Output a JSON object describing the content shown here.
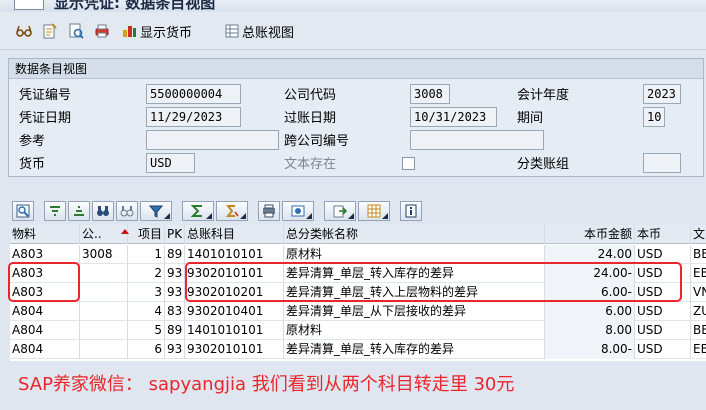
{
  "window": {
    "title": "显示凭证: 数据条目视图"
  },
  "toolbar": {
    "show_currency": "显示货币",
    "gl_view": "总账视图"
  },
  "panel": {
    "title": "数据条目视图",
    "doc_no_label": "凭证编号",
    "doc_no": "5500000004",
    "company_code_label": "公司代码",
    "company_code": "3008",
    "fiscal_year_label": "会计年度",
    "fiscal_year": "2023",
    "doc_date_label": "凭证日期",
    "doc_date": "11/29/2023",
    "posting_date_label": "过账日期",
    "posting_date": "10/31/2023",
    "period_label": "期间",
    "period": "10",
    "reference_label": "参考",
    "reference": "",
    "cross_cc_label": "跨公司编号",
    "cross_cc": "",
    "currency_label": "货币",
    "currency": "USD",
    "text_exists_label": "文本存在",
    "ledger_group_label": "分类账组",
    "ledger_group": ""
  },
  "grid": {
    "headers": {
      "material": "物料",
      "company": "公..",
      "item": "项目",
      "pk": "PK",
      "gl": "总账科目",
      "gl_name": "总分类帐名称",
      "amount": "本币金额",
      "currency": "本币",
      "text": "文"
    },
    "rows": [
      {
        "material": "A803",
        "company": "3008",
        "item": "1",
        "pk": "89",
        "gl": "1401010101",
        "gl_name": "原材料",
        "amount": "24.00",
        "currency": "USD",
        "text": "BE"
      },
      {
        "material": "A803",
        "company": "",
        "item": "2",
        "pk": "93",
        "gl": "9302010101",
        "gl_name": "差异清算_单层_转入库存的差异",
        "amount": "24.00-",
        "currency": "USD",
        "text": "EB"
      },
      {
        "material": "A803",
        "company": "",
        "item": "3",
        "pk": "93",
        "gl": "9302010201",
        "gl_name": "差异清算_单层_转入上层物料的差异",
        "amount": "6.00-",
        "currency": "USD",
        "text": "VN"
      },
      {
        "material": "A804",
        "company": "",
        "item": "4",
        "pk": "83",
        "gl": "9302010401",
        "gl_name": "差异清算_单层_从下层接收的差异",
        "amount": "6.00",
        "currency": "USD",
        "text": "ZU"
      },
      {
        "material": "A804",
        "company": "",
        "item": "5",
        "pk": "89",
        "gl": "1401010101",
        "gl_name": "原材料",
        "amount": "8.00",
        "currency": "USD",
        "text": "BE"
      },
      {
        "material": "A804",
        "company": "",
        "item": "6",
        "pk": "93",
        "gl": "9302010101",
        "gl_name": "差异清算_单层_转入库存的差异",
        "amount": "8.00-",
        "currency": "USD",
        "text": "EB"
      }
    ]
  },
  "annotation": "SAP养家微信： sapyangjia  我们看到从两个科目转走里 30元",
  "colors": {
    "highlight": "#e8262b",
    "panel_bg": "#e6ecf3",
    "header_bg": "#e4eaf2"
  }
}
